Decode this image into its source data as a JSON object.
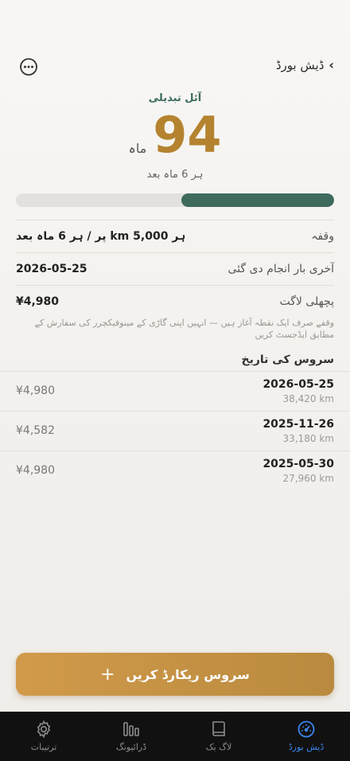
{
  "header": {
    "back_label": "ڈیش بورڈ"
  },
  "hero": {
    "title": "آئل تبدیلی",
    "value": "94",
    "unit": "ماہ",
    "subtitle": "ہر 6 ماہ بعد",
    "progress_fraction": 0.48
  },
  "info": {
    "interval_label": "وقفہ",
    "interval_value": "ہر 5,000 km پر / ہر 6 ماہ بعد",
    "last_done_label": "آخری بار انجام دی گئی",
    "last_done_value": "2026-05-25",
    "last_cost_label": "پچھلی لاگت",
    "last_cost_value": "¥4,980",
    "note": "وقفے صرف ایک نقطہ آغاز ہیں — انہیں اپنی گاڑی کے مینوفیکچرر کی سفارش کے مطابق ایڈجسٹ کریں"
  },
  "history": {
    "title": "سروس کی تاریخ",
    "rows": [
      {
        "date": "2026-05-25",
        "km": "38,420 km",
        "cost": "¥4,980"
      },
      {
        "date": "2025-11-26",
        "km": "33,180 km",
        "cost": "¥4,582"
      },
      {
        "date": "2025-05-30",
        "km": "27,960 km",
        "cost": "¥4,980"
      }
    ]
  },
  "cta": {
    "label": "سروس ریکارڈ کریں",
    "icon": "plus-icon"
  },
  "tabs": [
    {
      "label": "ترتیبات",
      "icon": "gear-icon",
      "active": false
    },
    {
      "label": "ڈرائیونگ",
      "icon": "bars-icon",
      "active": false
    },
    {
      "label": "لاگ بک",
      "icon": "book-icon",
      "active": false
    },
    {
      "label": "ڈیش بورڈ",
      "icon": "speedometer-icon",
      "active": true
    }
  ],
  "colors": {
    "accent": "#b5832f",
    "progress": "#3f6b5e",
    "tab_active": "#3a87ef"
  }
}
